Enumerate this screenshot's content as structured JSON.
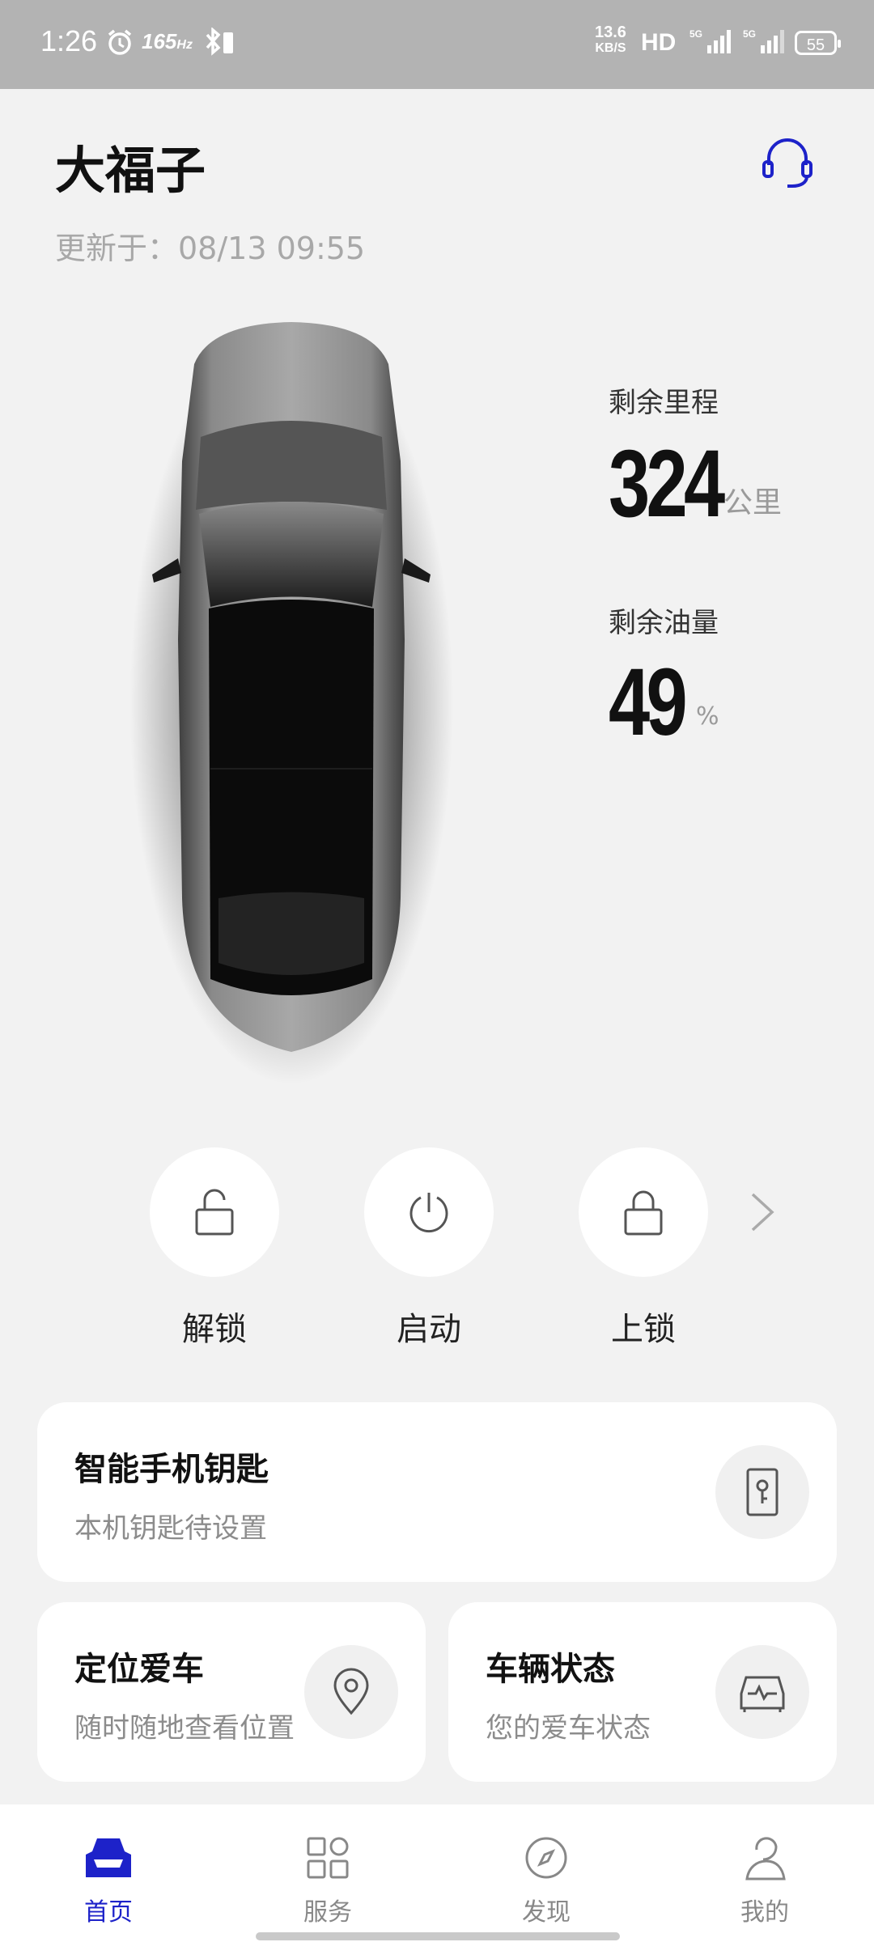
{
  "status_bar": {
    "time": "1:26",
    "refresh_rate": "165",
    "speed_value": "13.6",
    "speed_unit": "KB/S",
    "hd": "HD",
    "battery": "55"
  },
  "header": {
    "title": "大福子",
    "updated_label": "更新于：08/13 09:55"
  },
  "stats": {
    "range_label": "剩余里程",
    "range_value": "324",
    "range_unit": "公里",
    "fuel_label": "剩余油量",
    "fuel_value": "49",
    "fuel_unit": "%"
  },
  "controls": [
    {
      "label": "解锁",
      "icon": "unlock-icon"
    },
    {
      "label": "启动",
      "icon": "power-icon"
    },
    {
      "label": "上锁",
      "icon": "lock-icon"
    }
  ],
  "cards": {
    "phone_key": {
      "title": "智能手机钥匙",
      "subtitle": "本机钥匙待设置",
      "icon": "key-icon"
    },
    "locate": {
      "title": "定位爱车",
      "subtitle": "随时随地查看位置",
      "icon": "location-pin-icon"
    },
    "status": {
      "title": "车辆状态",
      "subtitle": "您的爱车状态",
      "icon": "car-status-icon"
    }
  },
  "nav": [
    {
      "label": "首页",
      "icon": "car-home-icon",
      "active": true
    },
    {
      "label": "服务",
      "icon": "grid-icon",
      "active": false
    },
    {
      "label": "发现",
      "icon": "compass-icon",
      "active": false
    },
    {
      "label": "我的",
      "icon": "person-icon",
      "active": false
    }
  ],
  "colors": {
    "accent": "#1d22c9",
    "background": "#f2f2f2",
    "status_bar": "#b3b3b3"
  }
}
